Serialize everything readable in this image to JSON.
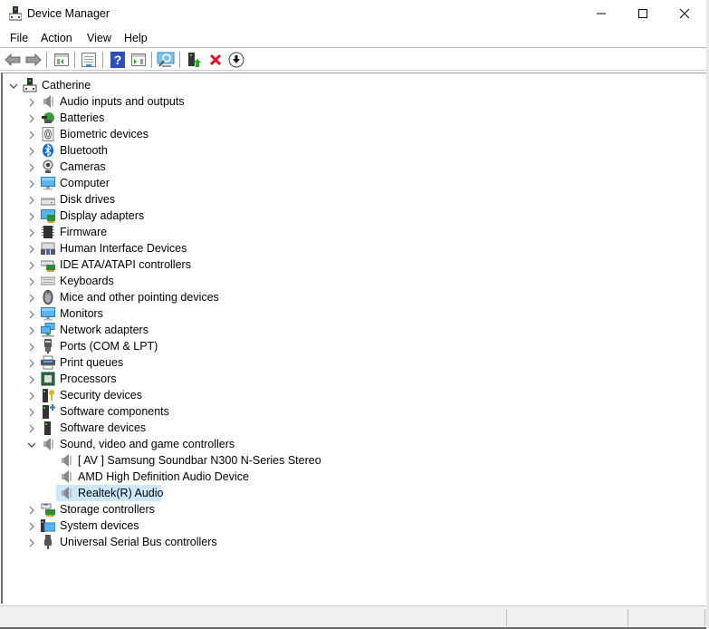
{
  "window": {
    "title": "Device Manager",
    "controls": {
      "minimize": "minimize",
      "maximize": "maximize",
      "close": "close"
    }
  },
  "menu": [
    "File",
    "Action",
    "View",
    "Help"
  ],
  "toolbar": [
    {
      "name": "back-button",
      "icon": "arrow-left-icon"
    },
    {
      "name": "forward-button",
      "icon": "arrow-right-icon"
    },
    {
      "name": "show-hide-console-tree-button",
      "icon": "console-tree-icon"
    },
    {
      "name": "properties-button",
      "icon": "properties-icon"
    },
    {
      "name": "help-button",
      "icon": "help-icon"
    },
    {
      "name": "show-action-pane-button",
      "icon": "action-pane-icon"
    },
    {
      "name": "scan-hardware-changes-button",
      "icon": "scan-monitor-icon"
    },
    {
      "name": "update-driver-button",
      "icon": "update-driver-icon"
    },
    {
      "name": "uninstall-device-button",
      "icon": "red-x-icon"
    },
    {
      "name": "disable-device-button",
      "icon": "down-arrow-circle-icon"
    }
  ],
  "tree": {
    "root": {
      "label": "Catherine",
      "icon": "computer-tower-icon",
      "expanded": true
    },
    "categories": [
      {
        "label": "Audio inputs and outputs",
        "icon": "speaker-icon"
      },
      {
        "label": "Batteries",
        "icon": "battery-icon"
      },
      {
        "label": "Biometric devices",
        "icon": "fingerprint-icon"
      },
      {
        "label": "Bluetooth",
        "icon": "bluetooth-icon"
      },
      {
        "label": "Cameras",
        "icon": "webcam-icon"
      },
      {
        "label": "Computer",
        "icon": "monitor-icon"
      },
      {
        "label": "Disk drives",
        "icon": "disk-drive-icon"
      },
      {
        "label": "Display adapters",
        "icon": "display-adapter-icon"
      },
      {
        "label": "Firmware",
        "icon": "chip-icon"
      },
      {
        "label": "Human Interface Devices",
        "icon": "hid-icon"
      },
      {
        "label": "IDE ATA/ATAPI controllers",
        "icon": "ide-controller-icon"
      },
      {
        "label": "Keyboards",
        "icon": "keyboard-icon"
      },
      {
        "label": "Mice and other pointing devices",
        "icon": "mouse-icon"
      },
      {
        "label": "Monitors",
        "icon": "monitor-icon"
      },
      {
        "label": "Network adapters",
        "icon": "network-icon"
      },
      {
        "label": "Ports (COM & LPT)",
        "icon": "port-icon"
      },
      {
        "label": "Print queues",
        "icon": "printer-icon"
      },
      {
        "label": "Processors",
        "icon": "processor-icon"
      },
      {
        "label": "Security devices",
        "icon": "security-key-icon"
      },
      {
        "label": "Software components",
        "icon": "software-component-icon"
      },
      {
        "label": "Software devices",
        "icon": "software-device-icon"
      },
      {
        "label": "Sound, video and game controllers",
        "icon": "speaker-icon",
        "expanded": true,
        "children": [
          {
            "label": "[ AV ] Samsung Soundbar N300 N-Series Stereo",
            "icon": "speaker-icon"
          },
          {
            "label": "AMD High Definition Audio Device",
            "icon": "speaker-icon"
          },
          {
            "label": "Realtek(R) Audio",
            "icon": "speaker-icon",
            "selected": true
          }
        ]
      },
      {
        "label": "Storage controllers",
        "icon": "storage-controller-icon"
      },
      {
        "label": "System devices",
        "icon": "system-devices-icon"
      },
      {
        "label": "Universal Serial Bus controllers",
        "icon": "usb-icon"
      }
    ]
  },
  "colors": {
    "selection": "#cce8ff",
    "accent_blue": "#0078d7",
    "red_x": "#e81123"
  }
}
